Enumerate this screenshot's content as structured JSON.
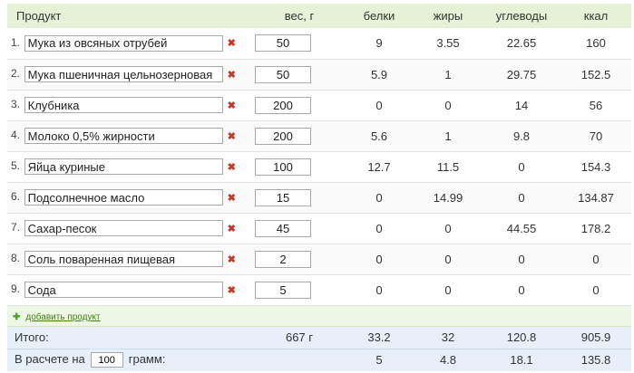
{
  "headers": {
    "product": "Продукт",
    "weight": "вес, г",
    "protein": "белки",
    "fat": "жиры",
    "carbs": "углеводы",
    "kcal": "ккал"
  },
  "rows": [
    {
      "index": "1.",
      "name": "Мука из овсяных отрубей",
      "weight": "50",
      "protein": "9",
      "fat": "3.55",
      "carbs": "22.65",
      "kcal": "160"
    },
    {
      "index": "2.",
      "name": "Мука пшеничная цельнозерновая",
      "weight": "50",
      "protein": "5.9",
      "fat": "1",
      "carbs": "29.75",
      "kcal": "152.5"
    },
    {
      "index": "3.",
      "name": "Клубника",
      "weight": "200",
      "protein": "0",
      "fat": "0",
      "carbs": "14",
      "kcal": "56"
    },
    {
      "index": "4.",
      "name": "Молоко 0,5% жирности",
      "weight": "200",
      "protein": "5.6",
      "fat": "1",
      "carbs": "9.8",
      "kcal": "70"
    },
    {
      "index": "5.",
      "name": "Яйца куриные",
      "weight": "100",
      "protein": "12.7",
      "fat": "11.5",
      "carbs": "0",
      "kcal": "154.3"
    },
    {
      "index": "6.",
      "name": "Подсолнечное масло",
      "weight": "15",
      "protein": "0",
      "fat": "14.99",
      "carbs": "0",
      "kcal": "134.87"
    },
    {
      "index": "7.",
      "name": "Сахар-песок",
      "weight": "45",
      "protein": "0",
      "fat": "0",
      "carbs": "44.55",
      "kcal": "178.2"
    },
    {
      "index": "8.",
      "name": "Соль поваренная пищевая",
      "weight": "2",
      "protein": "0",
      "fat": "0",
      "carbs": "0",
      "kcal": "0"
    },
    {
      "index": "9.",
      "name": "Сода",
      "weight": "5",
      "protein": "0",
      "fat": "0",
      "carbs": "0",
      "kcal": "0"
    }
  ],
  "delete_glyph": "✖",
  "add_product": {
    "plus": "✚",
    "label": "добавить продукт"
  },
  "total": {
    "label": "Итого:",
    "weight": "667 г",
    "protein": "33.2",
    "fat": "32",
    "carbs": "120.8",
    "kcal": "905.9"
  },
  "per": {
    "label_before": "В расчете на",
    "amount": "100",
    "label_after": "грамм:",
    "protein": "5",
    "fat": "4.8",
    "carbs": "18.1",
    "kcal": "135.8"
  },
  "colors": {
    "header_bg": "#e6f2d5",
    "totals_bg": "#e7f0f9",
    "delete_icon": "#c0392b",
    "add_link": "#3f7d1c"
  }
}
